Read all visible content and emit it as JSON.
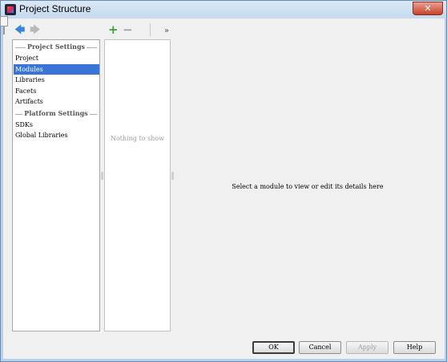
{
  "window": {
    "title": "Project Structure",
    "close_glyph": "✕"
  },
  "toolbar": {
    "back_glyph": "🡄",
    "forward_glyph": "🡆",
    "add_glyph": "+",
    "remove_glyph": "−",
    "more_glyph": "»"
  },
  "sidebar": {
    "groups": [
      {
        "title": "Project Settings",
        "items": [
          {
            "label": "Project",
            "selected": false
          },
          {
            "label": "Modules",
            "selected": true
          },
          {
            "label": "Libraries",
            "selected": false
          },
          {
            "label": "Facets",
            "selected": false
          },
          {
            "label": "Artifacts",
            "selected": false
          }
        ]
      },
      {
        "title": "Platform Settings",
        "items": [
          {
            "label": "SDKs",
            "selected": false
          },
          {
            "label": "Global Libraries",
            "selected": false
          }
        ]
      }
    ]
  },
  "modules_list": {
    "empty_text": "Nothing to show"
  },
  "details": {
    "placeholder": "Select a module to view or edit its details here"
  },
  "buttons": {
    "ok": "OK",
    "cancel": "Cancel",
    "apply": "Apply",
    "help": "Help"
  },
  "colors": {
    "selection": "#3875d7",
    "add_icon": "#39a339",
    "back_icon": "#3a85d6"
  }
}
